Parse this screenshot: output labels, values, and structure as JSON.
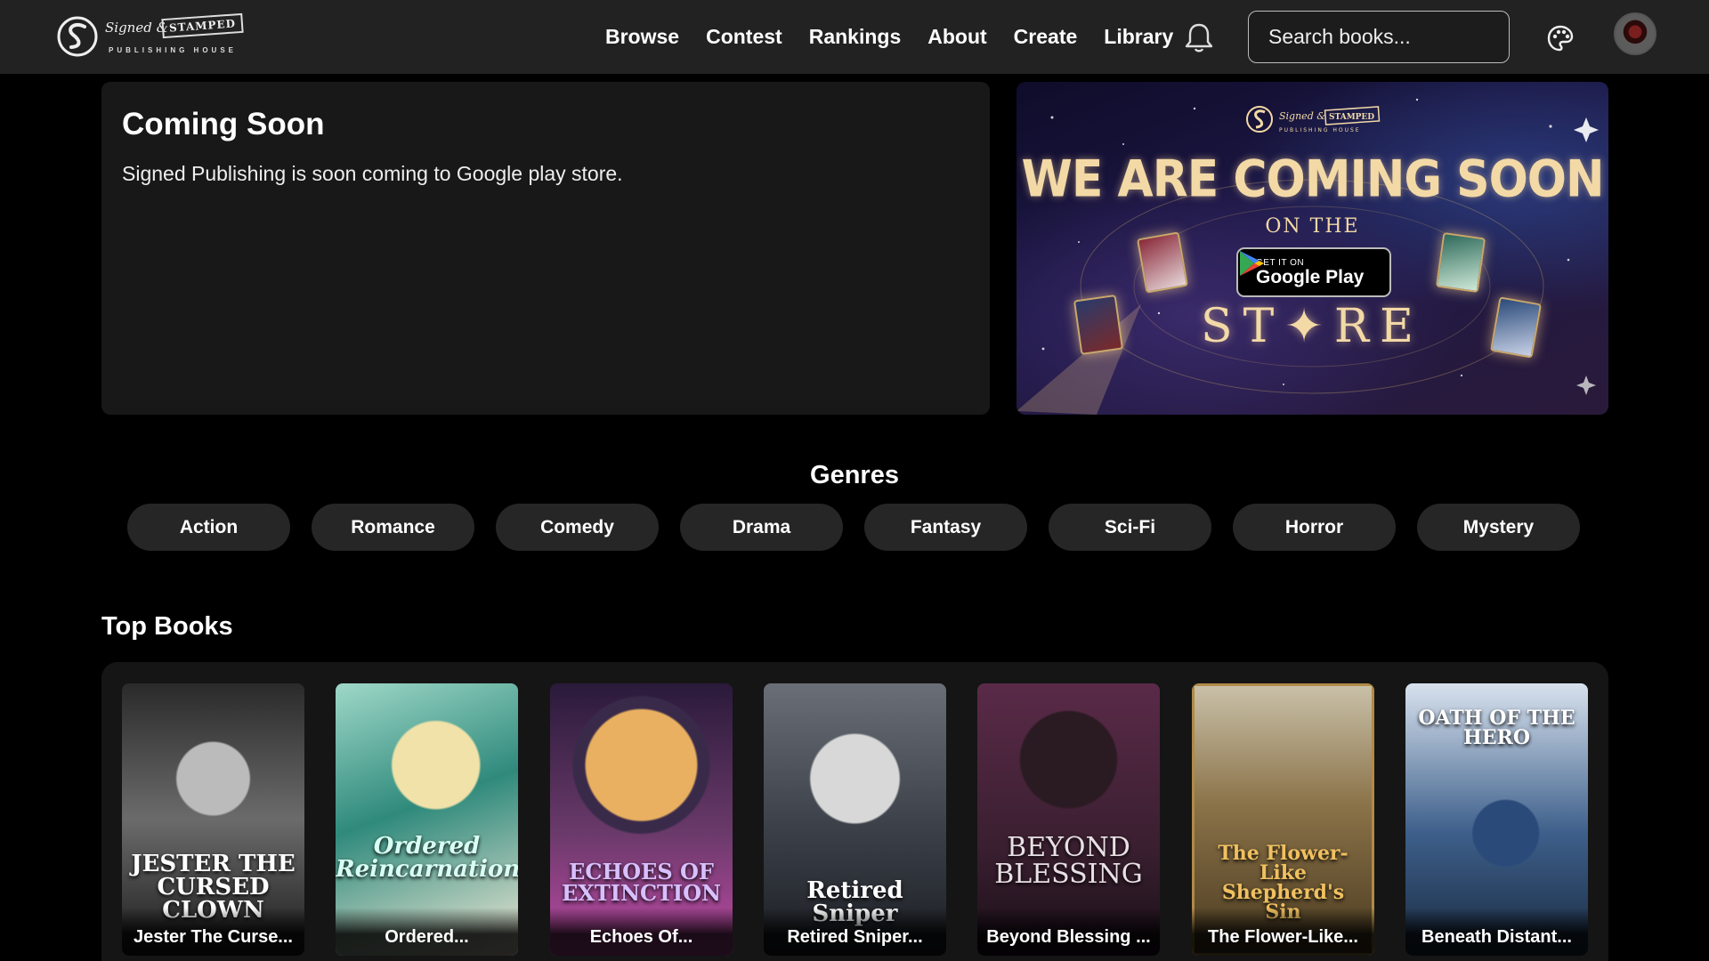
{
  "nav": {
    "logo": {
      "signed": "Signed &",
      "stamped": "STAMPED",
      "house": "PUBLISHING HOUSE"
    },
    "links": [
      "Browse",
      "Contest",
      "Rankings",
      "About",
      "Create",
      "Library"
    ],
    "search_placeholder": "Search books...",
    "icons": {
      "bell": "bell-icon",
      "palette": "palette-icon",
      "avatar": "user-avatar"
    }
  },
  "hero": {
    "title": "Coming Soon",
    "text": "Signed Publishing is soon coming to Google play store.",
    "banner": {
      "headline": "WE ARE COMING SOON",
      "on_the": "ON THE",
      "store": "ST✦RE",
      "badge_small": "GET IT ON",
      "badge_big": "Google Play"
    }
  },
  "genres": {
    "title": "Genres",
    "items": [
      "Action",
      "Romance",
      "Comedy",
      "Drama",
      "Fantasy",
      "Sci-Fi",
      "Horror",
      "Mystery"
    ]
  },
  "top_books": {
    "title": "Top Books",
    "items": [
      {
        "label": "Jester The Curse...",
        "cover": "JESTER THE CURSED CLOWN",
        "color": "#6b6b6b"
      },
      {
        "label": "Ordered...",
        "cover": "Ordered Reincarnation",
        "color": "#2f8a7c"
      },
      {
        "label": "Echoes Of...",
        "cover": "ECHOES OF EXTINCTION",
        "color": "#6a3a6a"
      },
      {
        "label": "Retired Sniper...",
        "cover": "Retired Sniper",
        "color": "#3a3f47"
      },
      {
        "label": "Beyond Blessing ...",
        "cover": "BEYOND BLESSING",
        "color": "#3a1f30"
      },
      {
        "label": "The Flower-Like...",
        "cover": "The Flower-Like Shepherd's Sin",
        "color": "#8a7248"
      },
      {
        "label": "Beneath Distant...",
        "cover": "OATH OF THE HERO",
        "color": "#3d5f8a"
      }
    ]
  }
}
